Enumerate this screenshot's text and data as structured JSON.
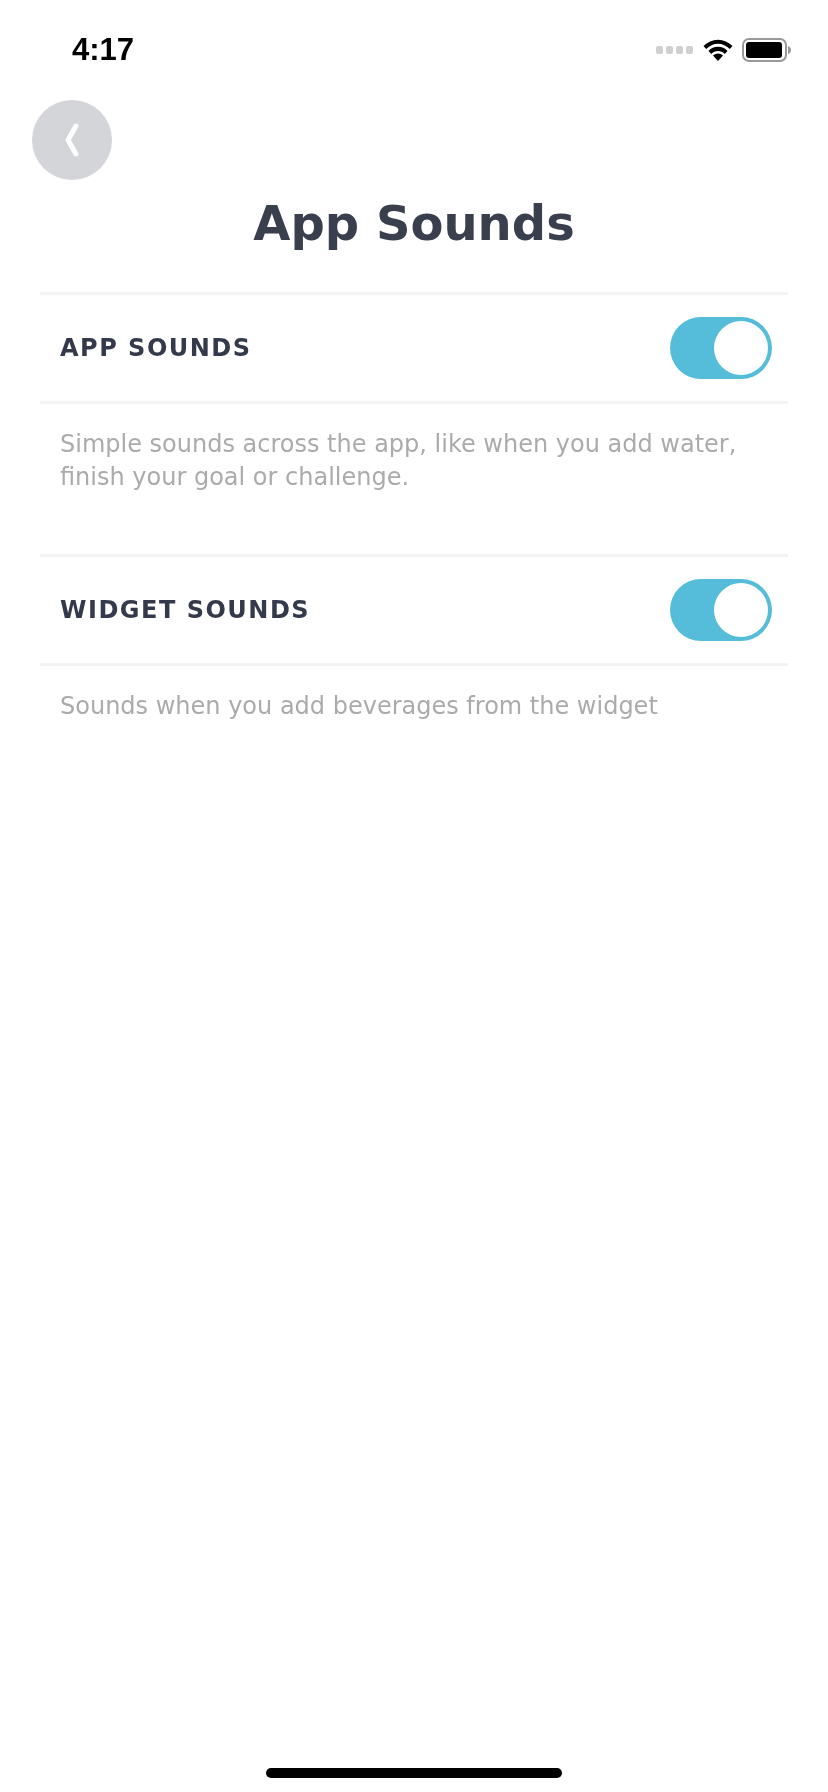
{
  "status_bar": {
    "time": "4:17"
  },
  "title": "App Sounds",
  "settings": [
    {
      "label": "APP SOUNDS",
      "on": true,
      "description": "Simple sounds across the app, like when you add water, finish your goal or challenge."
    },
    {
      "label": "WIDGET SOUNDS",
      "on": true,
      "description": "Sounds when you add beverages from the widget"
    }
  ]
}
